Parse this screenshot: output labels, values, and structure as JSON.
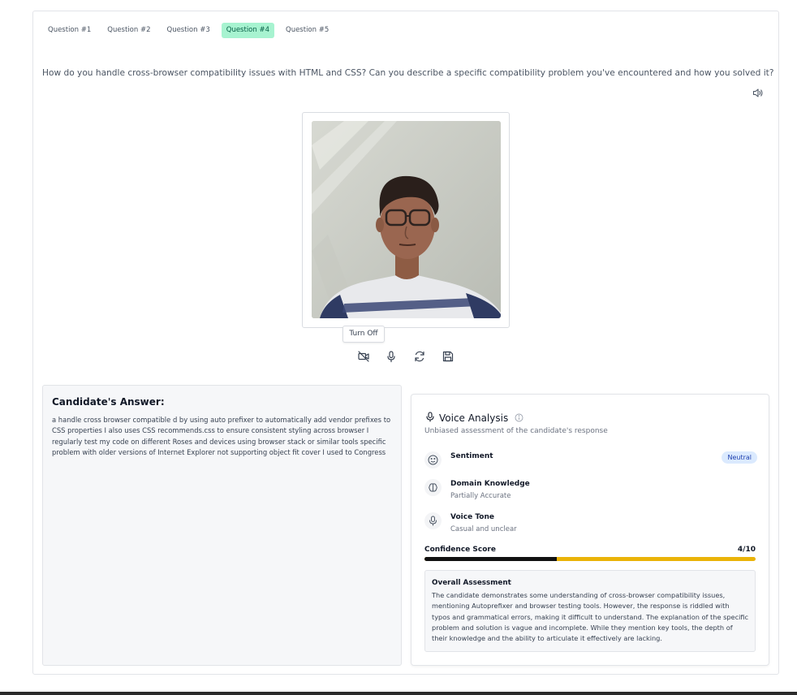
{
  "tabs": [
    {
      "label": "Question #1",
      "active": false
    },
    {
      "label": "Question #2",
      "active": false
    },
    {
      "label": "Question #3",
      "active": false
    },
    {
      "label": "Question #4",
      "active": true
    },
    {
      "label": "Question #5",
      "active": false
    }
  ],
  "question": "How do you handle cross-browser compatibility issues with HTML and CSS? Can you describe a specific compatibility problem you've encountered and how you solved it?",
  "icons": {
    "speaker": "speaker-icon",
    "camera_off": "camera-off-icon",
    "microphone": "microphone-icon",
    "refresh": "refresh-icon",
    "save": "save-icon"
  },
  "video": {
    "tooltip": "Turn Off"
  },
  "answer": {
    "title": "Candidate's Answer:",
    "text": "a handle cross browser compatible d by using auto prefixer to automatically add vendor prefixes to CSS properties I also uses CSS recommends.css to ensure consistent styling across browser I regularly test my code on different Roses and devices using browser stack or similar tools specific problem with older versions of Internet Explorer not supporting object fit cover I used to Congress"
  },
  "voice_analysis": {
    "title": "Voice Analysis",
    "subtitle": "Unbiased assessment of the candidate's response",
    "sentiment": {
      "label": "Sentiment",
      "badge": "Neutral"
    },
    "domain": {
      "label": "Domain Knowledge",
      "value": "Partially Accurate"
    },
    "tone": {
      "label": "Voice Tone",
      "value": "Casual and unclear"
    },
    "confidence": {
      "label": "Confidence Score",
      "value": "4/10",
      "score": 4,
      "max": 10
    },
    "overall": {
      "title": "Overall Assessment",
      "text": "The candidate demonstrates some understanding of cross-browser compatibility issues, mentioning Autoprefixer and browser testing tools. However, the response is riddled with typos and grammatical errors, making it difficult to understand. The explanation of the specific problem and solution is vague and incomplete. While they mention key tools, the depth of their knowledge and the ability to articulate it effectively are lacking."
    }
  },
  "colors": {
    "tab_active_bg": "#a7f3d0",
    "badge_bg": "#dbeafe",
    "confidence_track": "#eab308",
    "confidence_fill": "#111111"
  }
}
